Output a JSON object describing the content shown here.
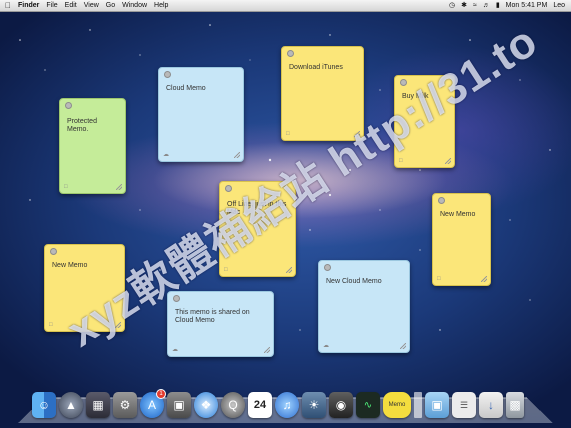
{
  "menubar": {
    "app_name": "Finder",
    "menus": [
      "File",
      "Edit",
      "View",
      "Go",
      "Window",
      "Help"
    ],
    "clock": "Mon 5:41 PM",
    "user": "Leo"
  },
  "memos": [
    {
      "text": "Protected Memo.",
      "color": "green"
    },
    {
      "text": "Cloud Memo",
      "color": "blue"
    },
    {
      "text": "Download iTunes",
      "color": "yellow"
    },
    {
      "text": "Buy Milk",
      "color": "yellow"
    },
    {
      "text": "Off Line, just in this Mac",
      "color": "yellow"
    },
    {
      "text": "New Memo",
      "color": "yellow"
    },
    {
      "text": "New Memo",
      "color": "yellow"
    },
    {
      "text": "This memo is shared on Cloud Memo",
      "color": "blue"
    },
    {
      "text": "New Cloud Memo",
      "color": "blue"
    }
  ],
  "dock": {
    "calendar_date": "24",
    "memo_app_label": "Memo",
    "appstore_badge": "1"
  },
  "watermark": "xyz軟體補給站 http://31.to",
  "colors": {
    "blue_memo": "#c7e6f7",
    "yellow_memo": "#fbe679",
    "green_memo": "#c5ec99"
  }
}
